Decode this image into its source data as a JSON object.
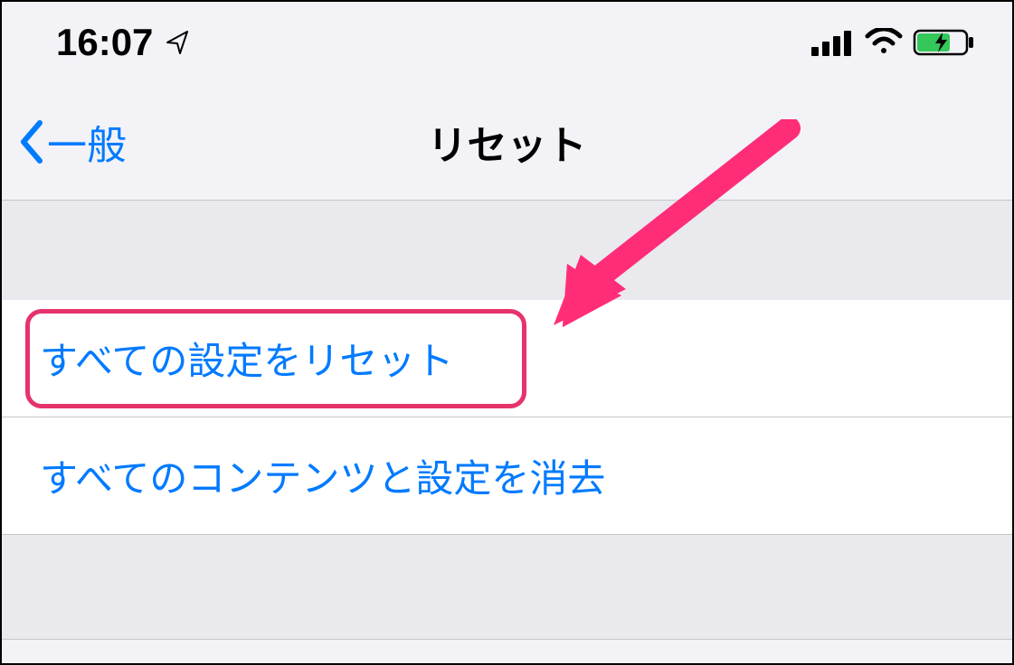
{
  "statusBar": {
    "time": "16:07"
  },
  "navBar": {
    "backLabel": "一般",
    "title": "リセット"
  },
  "list": {
    "items": [
      {
        "label": "すべての設定をリセット"
      },
      {
        "label": "すべてのコンテンツと設定を消去"
      }
    ]
  }
}
